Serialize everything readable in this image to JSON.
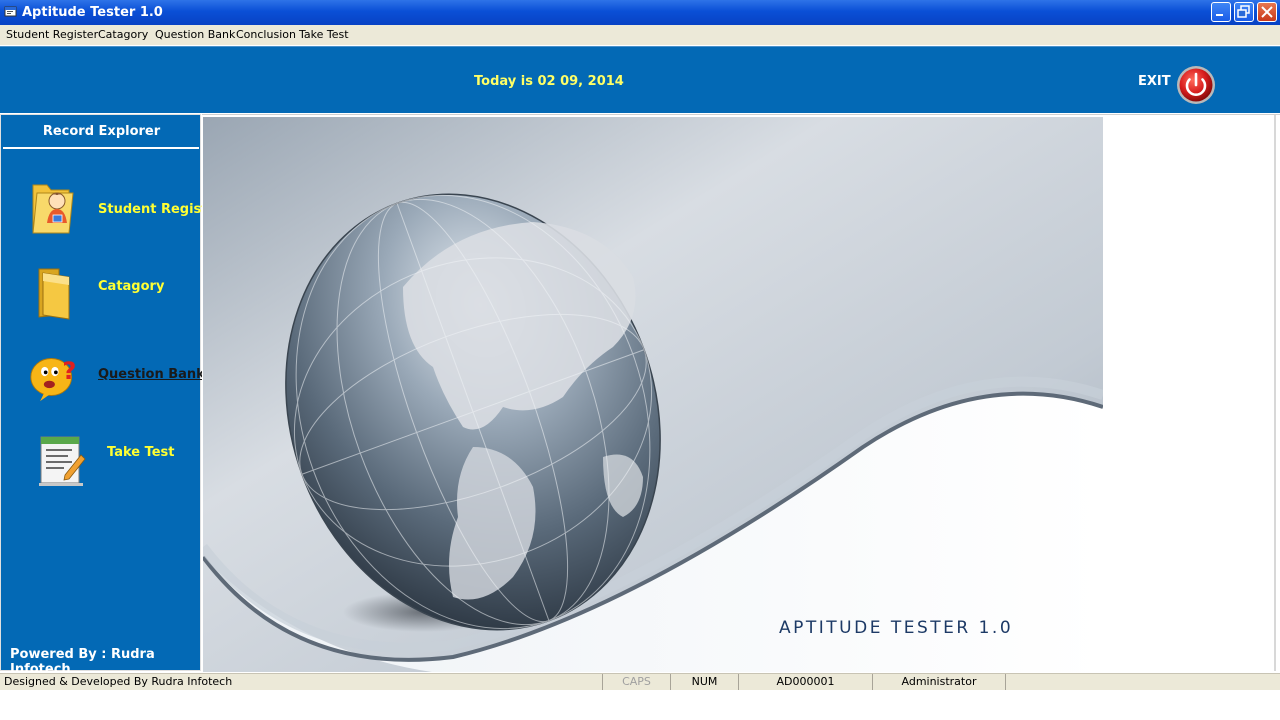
{
  "window": {
    "title": "Aptitude Tester 1.0"
  },
  "menu": [
    "Student Register",
    "Catagory",
    "Question Bank",
    "Conclusion",
    "Take Test"
  ],
  "header": {
    "date_text": "Today is 02 09, 2014",
    "exit_label": "EXIT"
  },
  "sidebar": {
    "title": "Record Explorer",
    "items": [
      {
        "label": "Student Register",
        "icon": "student-folder-icon"
      },
      {
        "label": "Catagory",
        "icon": "folder-icon"
      },
      {
        "label": "Question Bank",
        "icon": "question-face-icon"
      },
      {
        "label": "Take Test",
        "icon": "test-document-icon"
      }
    ],
    "powered_by": "Powered By : Rudra Infotech"
  },
  "splash": {
    "title": "APTITUDE TESTER 1.0"
  },
  "statusbar": {
    "designed_by": "Designed & Developed By Rudra Infotech",
    "caps": "CAPS",
    "num": "NUM",
    "code": "AD000001",
    "user": "Administrator"
  },
  "colors": {
    "panel_blue": "#0369b5",
    "accent_yellow": "#ffff33",
    "titlebar_blue": "#0a4fd6",
    "exit_red": "#d81e1e"
  }
}
